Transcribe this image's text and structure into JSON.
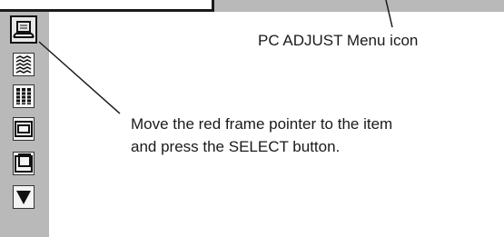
{
  "menu_bar": {
    "icon_name": "pc-adjust-menu-bar"
  },
  "icons": [
    {
      "name": "pc-adjust-icon",
      "selected": true
    },
    {
      "name": "fine-sync-icon",
      "selected": false
    },
    {
      "name": "total-dots-icon",
      "selected": false
    },
    {
      "name": "horizontal-position-icon",
      "selected": false
    },
    {
      "name": "vertical-position-icon",
      "selected": false
    },
    {
      "name": "scroll-down-icon",
      "selected": false
    }
  ],
  "callouts": {
    "menu_icon_label": "PC ADJUST Menu icon",
    "pointer_line_1": "Move the red frame pointer to the item",
    "pointer_line_2": "and press the SELECT button."
  },
  "colors": {
    "panel_gray": "#b9b9b9",
    "text": "#1a1a1a"
  }
}
